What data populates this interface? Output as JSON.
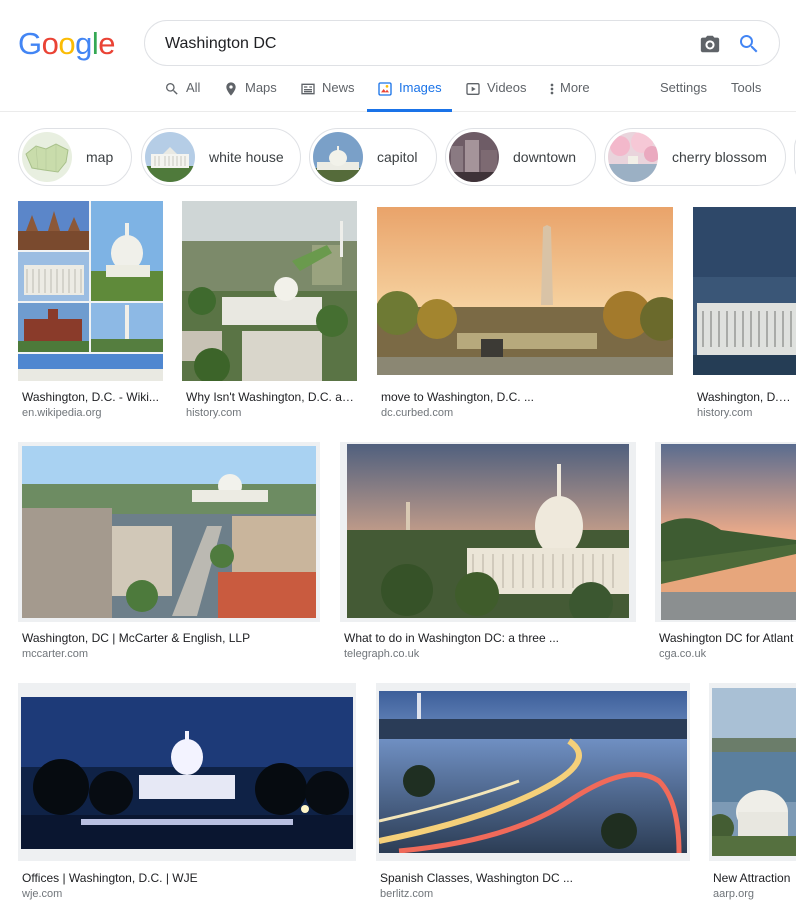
{
  "logo": {
    "text": "Google"
  },
  "search": {
    "value": "Washington DC"
  },
  "tabs": [
    {
      "label": "All",
      "icon": "search-icon"
    },
    {
      "label": "Maps",
      "icon": "map-pin-icon"
    },
    {
      "label": "News",
      "icon": "news-icon"
    },
    {
      "label": "Images",
      "icon": "image-icon",
      "active": true
    },
    {
      "label": "Videos",
      "icon": "video-icon"
    },
    {
      "label": "More",
      "icon": "more-vert-icon"
    }
  ],
  "tools": {
    "settings": "Settings",
    "tools": "Tools"
  },
  "chips": [
    {
      "label": "map"
    },
    {
      "label": "white house"
    },
    {
      "label": "capitol"
    },
    {
      "label": "downtown"
    },
    {
      "label": "cherry blossom"
    }
  ],
  "results": [
    {
      "title": "Washington, D.C. - Wiki...",
      "source": "en.wikipedia.org"
    },
    {
      "title": "Why Isn't Washington, D.C. a ...",
      "source": "history.com"
    },
    {
      "title": "move to Washington, D.C. ...",
      "source": "dc.curbed.com"
    },
    {
      "title": "Washington, D.C. -",
      "source": "history.com"
    },
    {
      "title": "Washington, DC | McCarter & English, LLP",
      "source": "mccarter.com"
    },
    {
      "title": "What to do in Washington DC: a three ...",
      "source": "telegraph.co.uk"
    },
    {
      "title": "Washington DC for Atlant",
      "source": "cga.co.uk"
    },
    {
      "title": "Offices | Washington, D.C. | WJE",
      "source": "wje.com"
    },
    {
      "title": "Spanish Classes, Washington DC ...",
      "source": "berlitz.com"
    },
    {
      "title": "New Attraction",
      "source": "aarp.org"
    }
  ],
  "colors": {
    "accent": "#1a73e8",
    "google_blue": "#4285f4",
    "google_red": "#ea4335",
    "google_yellow": "#fbbc05",
    "google_green": "#34a853"
  }
}
